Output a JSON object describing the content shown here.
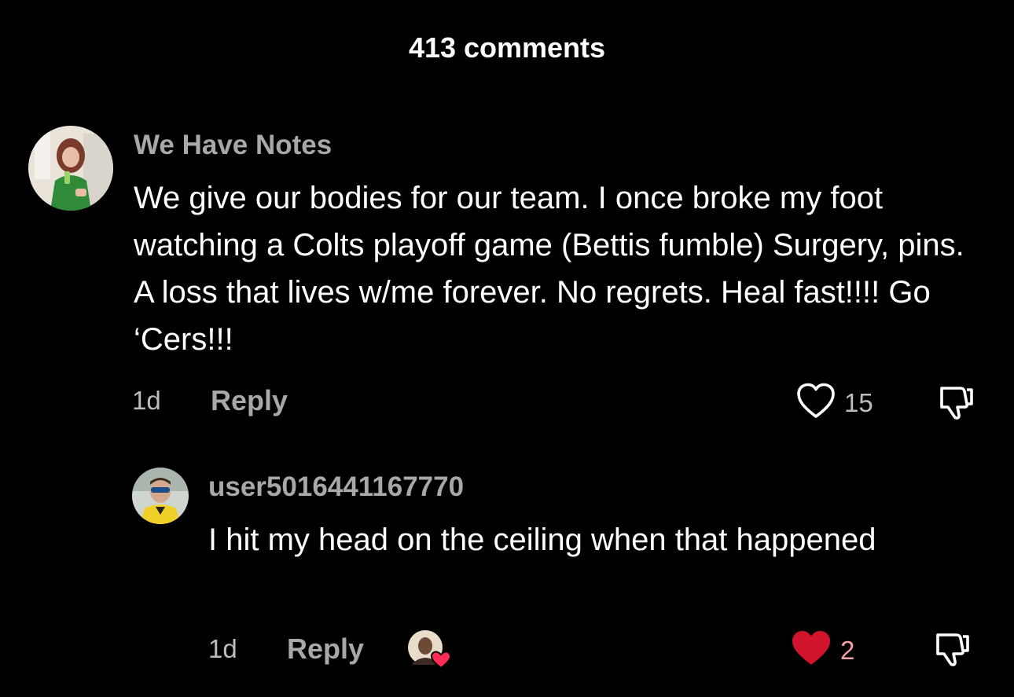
{
  "header": {
    "title": "413 comments"
  },
  "comments": [
    {
      "username": "We Have Notes",
      "text": "We give our bodies for our team. I once broke my foot watching a Colts playoff game (Bettis fumble) Surgery, pins. A loss that lives w/me forever. No regrets. Heal fast!!!! Go ‘Cers!!!",
      "time": "1d",
      "reply_label": "Reply",
      "likes": "15",
      "liked": false
    },
    {
      "username": "user5016441167770",
      "text": "I hit my head on the ceiling when that happened",
      "time": "1d",
      "reply_label": "Reply",
      "likes": "2",
      "liked": true
    }
  ],
  "colors": {
    "background": "#000000",
    "username": "#a8a8a8",
    "liked_heart": "#d0142c",
    "liked_count": "#f2a0a8"
  },
  "icons": [
    "heart-outline-icon",
    "heart-filled-icon",
    "dislike-icon",
    "creator-liked-badge-icon"
  ]
}
